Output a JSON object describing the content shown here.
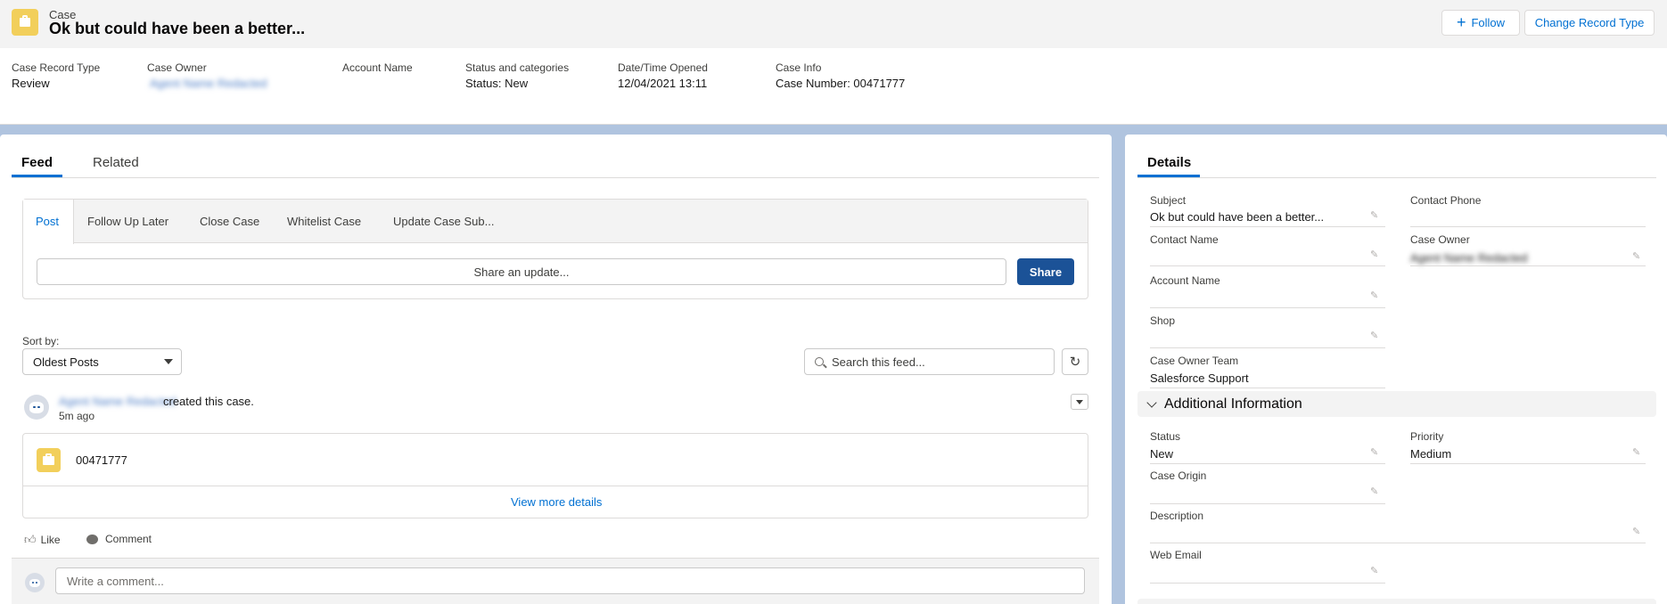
{
  "header": {
    "object_label": "Case",
    "title": "Ok but could have been a better...",
    "follow_label": "Follow",
    "change_record_type_label": "Change Record Type",
    "highlights": [
      {
        "label": "Case Record Type",
        "value": "Review"
      },
      {
        "label": "Case Owner",
        "value": "Agent Name Redacted"
      },
      {
        "label": "Account Name",
        "value": ""
      },
      {
        "label": "Status and categories",
        "value": "Status: New"
      },
      {
        "label": "Date/Time Opened",
        "value": "12/04/2021 13:11"
      },
      {
        "label": "Case Info",
        "value": "Case Number: 00471777"
      }
    ]
  },
  "feed": {
    "tabs": [
      {
        "label": "Feed",
        "active": true
      },
      {
        "label": "Related",
        "active": false
      }
    ],
    "publisher_tabs": [
      "Post",
      "Follow Up Later",
      "Close Case",
      "Whitelist Case",
      "Update Case Sub..."
    ],
    "share_placeholder": "Share an update...",
    "share_button": "Share",
    "sort_label": "Sort by:",
    "sort_value": "Oldest Posts",
    "search_placeholder": "Search this feed...",
    "post": {
      "author": "Agent Name Redacted",
      "action_text": "created this case.",
      "time": "5m ago",
      "case_number": "00471777",
      "view_more": "View more details"
    },
    "like_label": "Like",
    "comment_label": "Comment",
    "comment_placeholder": "Write a comment..."
  },
  "details": {
    "tab_label": "Details",
    "fields_top": [
      {
        "label": "Subject",
        "value": "Ok but could have been a better..."
      },
      {
        "label": "Contact Phone",
        "value": ""
      },
      {
        "label": "Contact Name",
        "value": ""
      },
      {
        "label": "Case Owner",
        "value": "Agent Name Redacted"
      },
      {
        "label": "Account Name",
        "value": ""
      },
      {
        "label": "Shop",
        "value": ""
      },
      {
        "label": "Case Owner Team",
        "value": "Salesforce Support"
      }
    ],
    "section_title": "Additional Information",
    "fields_additional": [
      {
        "label": "Status",
        "value": "New"
      },
      {
        "label": "Priority",
        "value": "Medium"
      },
      {
        "label": "Case Origin",
        "value": ""
      },
      {
        "label": "Description",
        "value": ""
      },
      {
        "label": "Web Email",
        "value": ""
      }
    ]
  },
  "colors": {
    "accent": "#0070d2",
    "share_button": "#1b5297",
    "case_icon": "#f2cf5b",
    "page_bg": "#b0c4df"
  },
  "icons": [
    "case-icon",
    "plus-icon",
    "search-icon",
    "refresh-icon",
    "chevron-down-icon",
    "pencil-icon",
    "like-icon",
    "comment-icon",
    "avatar"
  ]
}
